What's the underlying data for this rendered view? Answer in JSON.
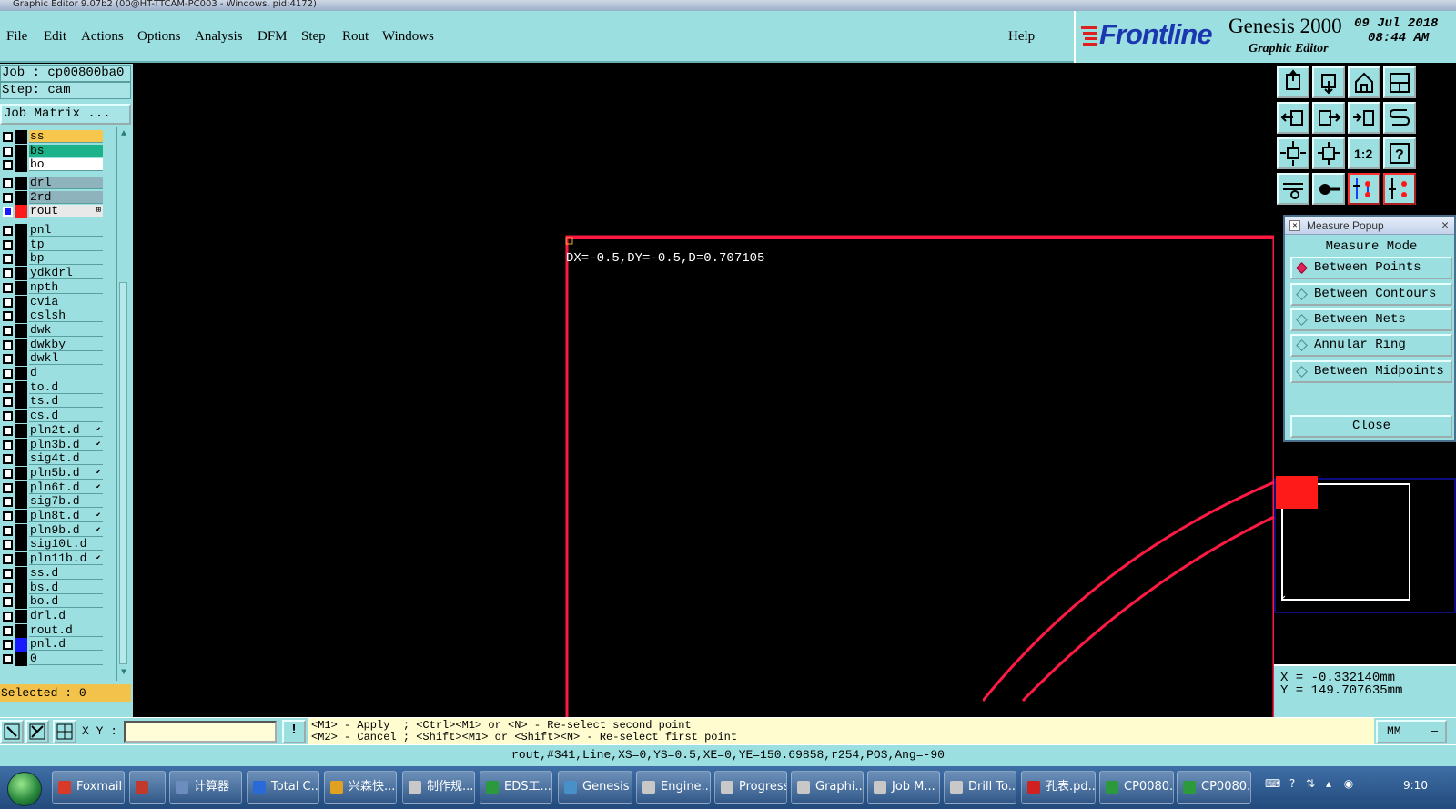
{
  "window": {
    "title": "Graphic Editor 9.07b2 (00@HT-TTCAM-PC003 - Windows, pid:4172)"
  },
  "menu": {
    "items": [
      "File",
      "Edit",
      "Actions",
      "Options",
      "Analysis",
      "DFM",
      "Step",
      "Rout",
      "Windows"
    ],
    "help": "Help"
  },
  "brand": {
    "logo": "Frontline",
    "product": "Genesis 2000",
    "subtitle": "Graphic Editor",
    "date": "09 Jul 2018",
    "time": "08:44 AM"
  },
  "job": {
    "job_label": "Job : cp00800ba0",
    "step_label": "Step: cam",
    "matrix_button": "Job Matrix ..."
  },
  "layers": [
    {
      "name": "ss",
      "bg": "#f7c64c",
      "mark": "",
      "flag": ""
    },
    {
      "name": "bs",
      "bg": "#1cb28a",
      "mark": "",
      "flag": ""
    },
    {
      "name": "bo",
      "bg": "#ffffff",
      "mark": "",
      "flag": ""
    },
    {
      "name": "drl",
      "bg": "#8fb3bd",
      "mark": "",
      "flag": ""
    },
    {
      "name": "2rd",
      "bg": "#8fb3bd",
      "mark": "",
      "flag": ""
    },
    {
      "name": "rout",
      "bg": "#e9e9e9",
      "mark": "#ff1a1a",
      "flag": "⊞"
    },
    {
      "name": "pnl",
      "bg": "",
      "mark": "",
      "flag": ""
    },
    {
      "name": "tp",
      "bg": "",
      "mark": "",
      "flag": ""
    },
    {
      "name": "bp",
      "bg": "",
      "mark": "",
      "flag": ""
    },
    {
      "name": "ydkdrl",
      "bg": "",
      "mark": "",
      "flag": ""
    },
    {
      "name": "npth",
      "bg": "",
      "mark": "",
      "flag": ""
    },
    {
      "name": "cvia",
      "bg": "",
      "mark": "",
      "flag": ""
    },
    {
      "name": "cslsh",
      "bg": "",
      "mark": "",
      "flag": ""
    },
    {
      "name": "dwk",
      "bg": "",
      "mark": "",
      "flag": ""
    },
    {
      "name": "dwkby",
      "bg": "",
      "mark": "",
      "flag": ""
    },
    {
      "name": "dwkl",
      "bg": "",
      "mark": "",
      "flag": ""
    },
    {
      "name": "d",
      "bg": "",
      "mark": "",
      "flag": ""
    },
    {
      "name": "to.d",
      "bg": "",
      "mark": "",
      "flag": ""
    },
    {
      "name": "ts.d",
      "bg": "",
      "mark": "",
      "flag": ""
    },
    {
      "name": "cs.d",
      "bg": "",
      "mark": "",
      "flag": ""
    },
    {
      "name": "pln2t.d",
      "bg": "",
      "mark": "",
      "flag": "⬋"
    },
    {
      "name": "pln3b.d",
      "bg": "",
      "mark": "",
      "flag": "⬋"
    },
    {
      "name": "sig4t.d",
      "bg": "",
      "mark": "",
      "flag": ""
    },
    {
      "name": "pln5b.d",
      "bg": "",
      "mark": "",
      "flag": "⬋"
    },
    {
      "name": "pln6t.d",
      "bg": "",
      "mark": "",
      "flag": "⬋"
    },
    {
      "name": "sig7b.d",
      "bg": "",
      "mark": "",
      "flag": ""
    },
    {
      "name": "pln8t.d",
      "bg": "",
      "mark": "",
      "flag": "⬋"
    },
    {
      "name": "pln9b.d",
      "bg": "",
      "mark": "",
      "flag": "⬋"
    },
    {
      "name": "sig10t.d",
      "bg": "",
      "mark": "",
      "flag": ""
    },
    {
      "name": "pln11b.d",
      "bg": "",
      "mark": "",
      "flag": "⬋"
    },
    {
      "name": "ss.d",
      "bg": "",
      "mark": "",
      "flag": ""
    },
    {
      "name": "bs.d",
      "bg": "",
      "mark": "",
      "flag": ""
    },
    {
      "name": "bo.d",
      "bg": "",
      "mark": "",
      "flag": ""
    },
    {
      "name": "drl.d",
      "bg": "",
      "mark": "",
      "flag": ""
    },
    {
      "name": "rout.d",
      "bg": "",
      "mark": "",
      "flag": ""
    },
    {
      "name": "pnl.d",
      "bg": "",
      "mark": "#1a1aff",
      "flag": ""
    },
    {
      "name": "0",
      "bg": "",
      "mark": "",
      "flag": ""
    }
  ],
  "selected": {
    "label": "Selected : 0"
  },
  "canvas": {
    "measure_text": "DX=-0.5,DY=-0.5,D=0.707105",
    "line_color": "#ff1a44"
  },
  "toolbar": {
    "buttons": [
      "zoom-home-icon",
      "zoom-previous-icon",
      "home-icon",
      "window-fit-icon",
      "pan-left-icon",
      "pan-right-icon",
      "reflect-icon",
      "snap-icon",
      "fit-all-icon",
      "fit-center-icon",
      "scale-one-to-two-icon",
      "help-query-icon",
      "settings-tool-icon",
      "measure-tool-icon",
      "net-select-icon",
      "net-highlight-icon"
    ]
  },
  "measure_popup": {
    "title": "Measure Popup",
    "mode_label": "Measure Mode",
    "options": [
      {
        "label": "Between Points",
        "selected": true
      },
      {
        "label": "Between Contours",
        "selected": false
      },
      {
        "label": "Between Nets",
        "selected": false
      },
      {
        "label": "Annular Ring",
        "selected": false
      },
      {
        "label": "Between Midpoints",
        "selected": false
      }
    ],
    "close_label": "Close"
  },
  "coords": {
    "x": "X = -0.332140mm",
    "y": "Y = 149.707635mm"
  },
  "command": {
    "xy_label": "X Y :",
    "xy_value": "",
    "hint_line1": "<M1> - Apply  ; <Ctrl><M1> or <N> - Re-select second point",
    "hint_line2": "<M2> - Cancel ; <Shift><M1> or <Shift><N> - Re-select first point",
    "unit": "MM",
    "unit_dash": "—"
  },
  "info": {
    "text": "rout,#341,Line,XS=0,YS=0.5,XE=0,YE=150.69858,r254,POS,Ang=-90"
  },
  "taskbar": {
    "tasks": [
      {
        "label": "Foxmail",
        "color": "#d83a2a"
      },
      {
        "label": "",
        "color": "#c0392b"
      },
      {
        "label": "计算器",
        "color": "#6c8cc0"
      },
      {
        "label": "Total C...",
        "color": "#2a6ad8"
      },
      {
        "label": "兴森快...",
        "color": "#e0a020"
      },
      {
        "label": "制作规...",
        "color": "#c8c8c8"
      },
      {
        "label": "EDS工...",
        "color": "#2c9a3c"
      },
      {
        "label": "Genesis",
        "color": "#4a90c8"
      },
      {
        "label": "Engine...",
        "color": "#c8c8c8"
      },
      {
        "label": "Progress",
        "color": "#c8c8c8"
      },
      {
        "label": "Graphi...",
        "color": "#c8c8c8"
      },
      {
        "label": "Job M...",
        "color": "#c8c8c8"
      },
      {
        "label": "Drill To...",
        "color": "#c8c8c8"
      },
      {
        "label": "孔表.pd...",
        "color": "#d02020"
      },
      {
        "label": "CP0080...",
        "color": "#2c9a3c"
      },
      {
        "label": "CP0080...",
        "color": "#2c9a3c"
      }
    ],
    "time": "9:10"
  }
}
